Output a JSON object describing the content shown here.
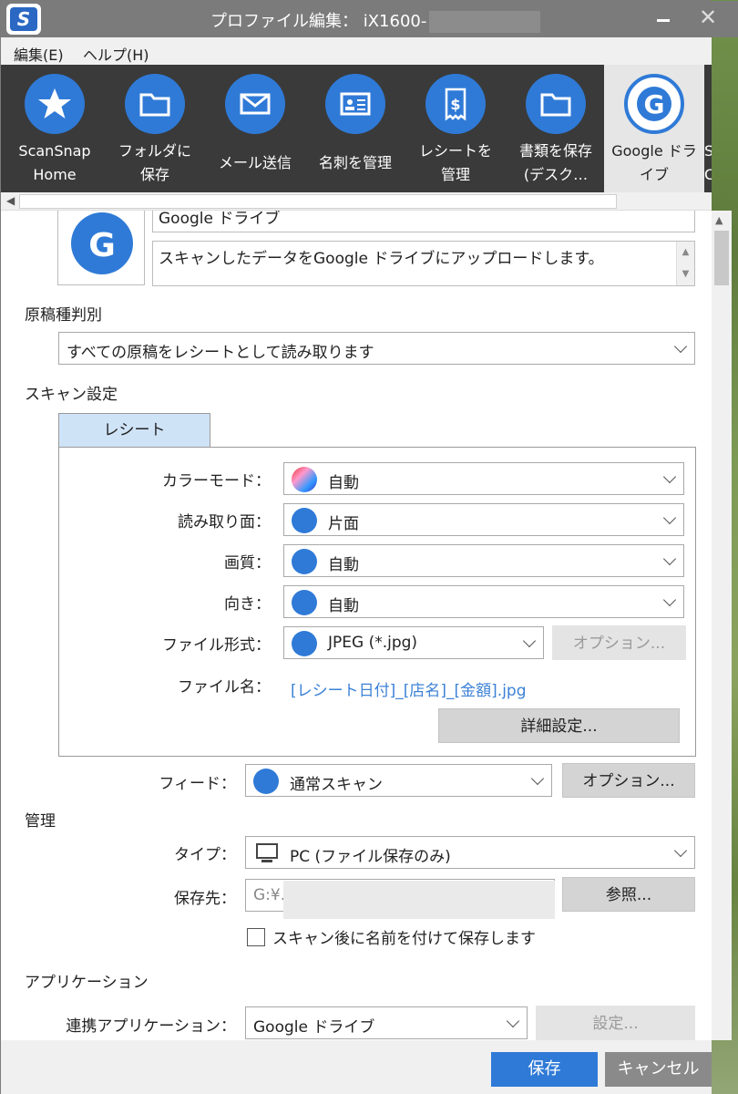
{
  "window": {
    "title": "プロファイル編集： iX1600-",
    "minimize_label": "—",
    "close_label": "✕"
  },
  "menu": {
    "edit": "編集(E)",
    "help": "ヘルプ(H)"
  },
  "profiles": [
    {
      "label1": "ScanSnap",
      "label2": "Home",
      "icon": "star-icon"
    },
    {
      "label1": "フォルダに",
      "label2": "保存",
      "icon": "folder-icon"
    },
    {
      "label1": "メール送信",
      "label2": "",
      "icon": "mail-icon"
    },
    {
      "label1": "名刺を管理",
      "label2": "",
      "icon": "business-card-icon"
    },
    {
      "label1": "レシートを",
      "label2": "管理",
      "icon": "receipt-icon"
    },
    {
      "label1": "書類を保存",
      "label2": "(デスク…",
      "icon": "folder-icon"
    },
    {
      "label1": "Google ドラ",
      "label2": "イブ",
      "icon": "google-icon",
      "selected": true
    },
    {
      "label1": "Sc",
      "label2": "Clo",
      "icon": "cloud-icon"
    }
  ],
  "profile_info": {
    "name": "Google ドライブ",
    "description": "スキャンしたデータをGoogle ドライブにアップロードします。"
  },
  "document_type": {
    "label": "原稿種判別",
    "value": "すべての原稿をレシートとして読み取ります"
  },
  "scan_settings": {
    "label": "スキャン設定",
    "tab": "レシート",
    "color_mode": {
      "label": "カラーモード：",
      "value": "自動"
    },
    "scan_side": {
      "label": "読み取り面：",
      "value": "片面"
    },
    "quality": {
      "label": "画質：",
      "value": "自動"
    },
    "orientation": {
      "label": "向き：",
      "value": "自動"
    },
    "file_format": {
      "label": "ファイル形式：",
      "value": "JPEG (*.jpg)",
      "option_button": "オプション..."
    },
    "file_name": {
      "label": "ファイル名：",
      "value": "[レシート日付]_[店名]_[金額].jpg"
    },
    "detail_button": "詳細設定..."
  },
  "feed": {
    "label": "フィード：",
    "value": "通常スキャン",
    "option_button": "オプション..."
  },
  "management": {
    "label": "管理",
    "type_label": "タイプ：",
    "type_value": "PC (ファイル保存のみ)",
    "save_to_label": "保存先：",
    "save_to_value": "G:¥.",
    "browse_button": "参照...",
    "rename_checkbox": "スキャン後に名前を付けて保存します"
  },
  "application": {
    "label": "アプリケーション",
    "linked_label": "連携アプリケーション：",
    "linked_value": "Google ドライブ",
    "settings_button": "設定..."
  },
  "footer": {
    "save": "保存",
    "cancel": "キャンセル"
  },
  "colors": {
    "accent": "#2f7ad7",
    "titlebar": "#7b7b7b",
    "strip": "#3a3a3a",
    "link": "#3c82d6"
  }
}
